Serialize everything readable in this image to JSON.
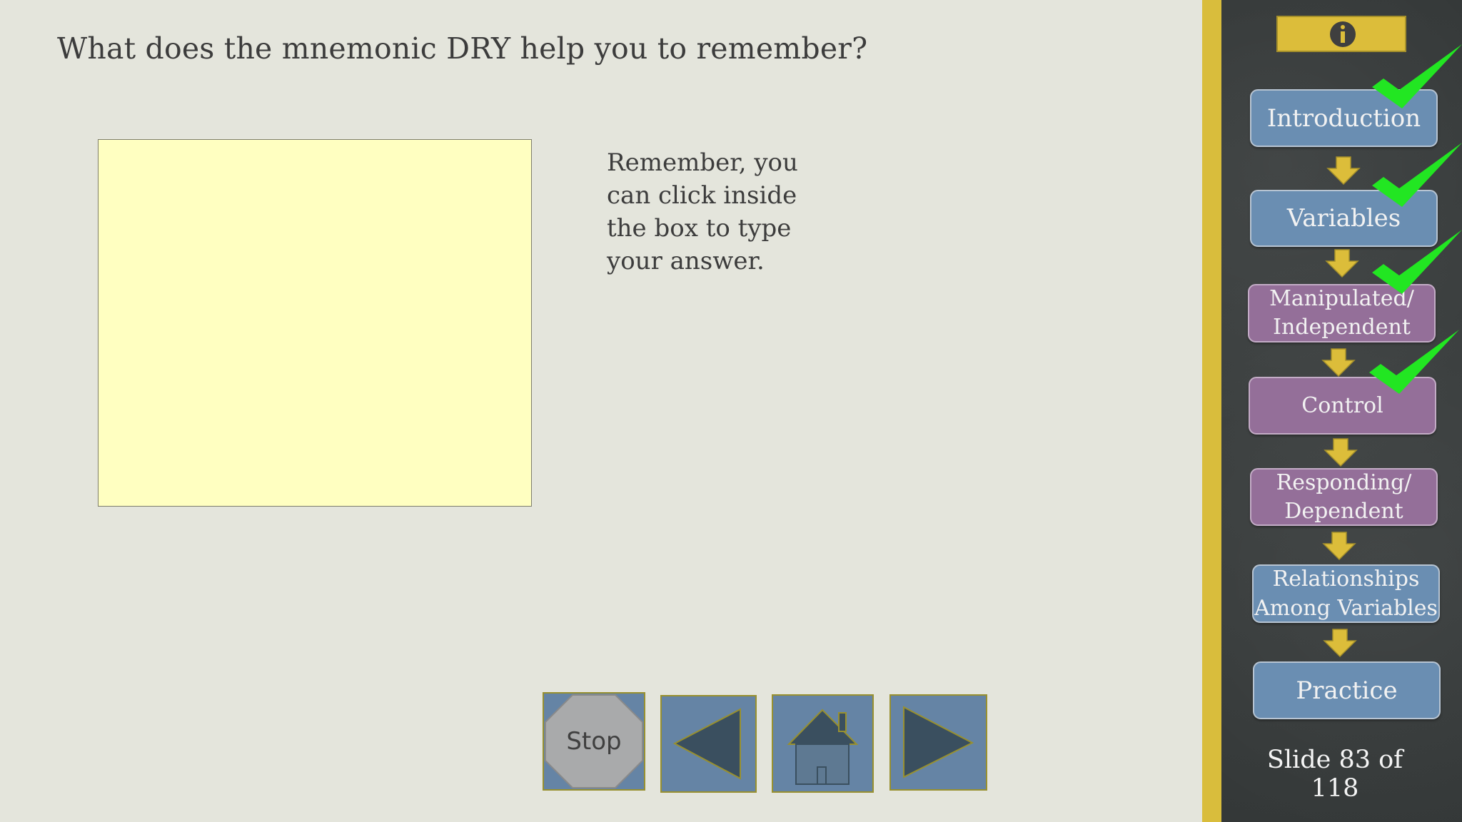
{
  "question": "What does the mnemonic DRY help you to remember?",
  "hint": "Remember, you can click inside the box to type your answer.",
  "nav": {
    "stop_label": "Stop",
    "accent": "#6584a5",
    "icons": [
      "stop-icon",
      "back-arrow-icon",
      "home-icon",
      "forward-arrow-icon"
    ]
  },
  "sidebar": {
    "info_icon": "info-icon",
    "topics": [
      {
        "label": "Introduction",
        "color": "blue",
        "checked": true
      },
      {
        "label": "Variables",
        "color": "blue",
        "checked": true
      },
      {
        "label": "Manipulated/\nIndependent",
        "color": "purple",
        "checked": true
      },
      {
        "label": "Control",
        "color": "purple",
        "checked": true
      },
      {
        "label": "Responding/\nDependent",
        "color": "purple",
        "checked": false
      },
      {
        "label": "Relationships\nAmong Variables",
        "color": "blue",
        "checked": false
      },
      {
        "label": "Practice",
        "color": "blue",
        "checked": false
      }
    ],
    "slide_counter": "Slide 83 of 118"
  },
  "colors": {
    "background": "#e4e5dc",
    "answer_box": "#ffffc1",
    "sidebar": "#383c3c",
    "stripe": "#d9bd3c",
    "topic_blue": "#6a8eb2",
    "topic_purple": "#946f99",
    "check": "#22e622"
  }
}
